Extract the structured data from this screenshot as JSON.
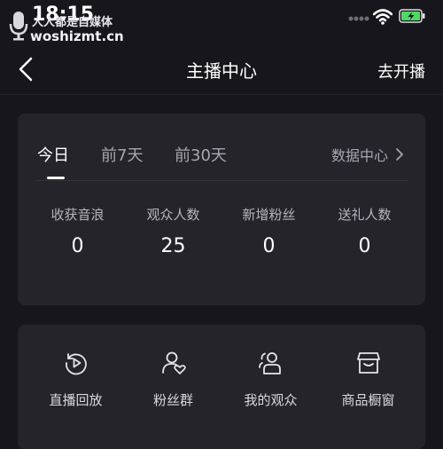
{
  "status_bar": {
    "time": "18:15",
    "watermark_line1": "人人都是自媒体",
    "watermark_line2": "woshizmt.cn"
  },
  "nav": {
    "title": "主播中心",
    "action_label": "去开播"
  },
  "tabs": [
    {
      "label": "今日",
      "active": true
    },
    {
      "label": "前7天",
      "active": false
    },
    {
      "label": "前30天",
      "active": false
    }
  ],
  "data_center_label": "数据中心",
  "stats": [
    {
      "label": "收获音浪",
      "value": "0"
    },
    {
      "label": "观众人数",
      "value": "25"
    },
    {
      "label": "新增粉丝",
      "value": "0"
    },
    {
      "label": "送礼人数",
      "value": "0"
    }
  ],
  "tools": [
    {
      "label": "直播回放",
      "icon": "replay-icon"
    },
    {
      "label": "粉丝群",
      "icon": "fan-group-icon"
    },
    {
      "label": "我的观众",
      "icon": "audience-icon"
    },
    {
      "label": "商品橱窗",
      "icon": "shop-window-icon"
    }
  ],
  "colors": {
    "background": "#17161c",
    "card": "#25242b",
    "battery": "#4cd964"
  }
}
